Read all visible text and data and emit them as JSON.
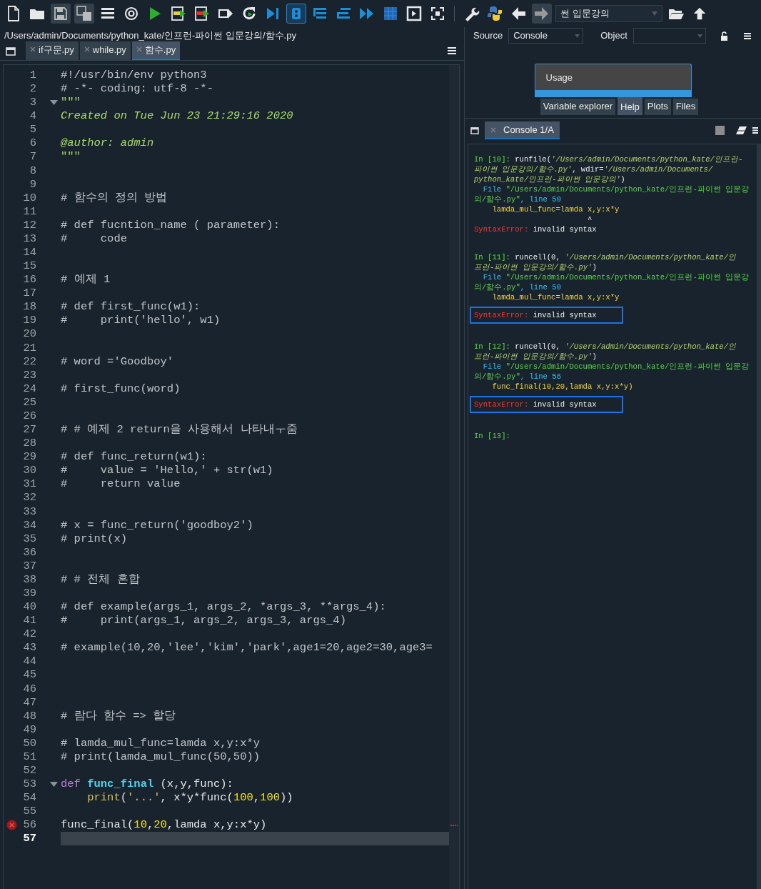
{
  "toolbar": {
    "directory": "썬 입문강의"
  },
  "editor": {
    "path": "/Users/admin/Documents/python_kate/인프런-파이썬 입문강의/함수.py",
    "tabs": [
      {
        "label": "if구문.py",
        "selected": false
      },
      {
        "label": "while.py",
        "selected": false
      },
      {
        "label": "함수.py",
        "selected": true
      }
    ],
    "lines": [
      {
        "number": "1",
        "tokens": [
          {
            "text": "#!/usr/bin/env python3",
            "kind": "comment"
          }
        ]
      },
      {
        "number": "2",
        "tokens": [
          {
            "text": "# -*- coding: utf-8 -*-",
            "kind": "comment"
          }
        ]
      },
      {
        "number": "3",
        "kind": "fold",
        "tokens": [
          {
            "text": "\"\"\"",
            "kind": "docquote"
          }
        ]
      },
      {
        "number": "4",
        "tokens": [
          {
            "text": "Created on Tue Jun 23 21:29:16 2020",
            "kind": "docstring"
          }
        ]
      },
      {
        "number": "5"
      },
      {
        "number": "6",
        "tokens": [
          {
            "text": "@author: admin",
            "kind": "docstring"
          }
        ]
      },
      {
        "number": "7",
        "tokens": [
          {
            "text": "\"\"\"",
            "kind": "docquote"
          }
        ]
      },
      {
        "number": "8"
      },
      {
        "number": "9"
      },
      {
        "number": "10",
        "tokens": [
          {
            "text": "# 함수의 정의 방법",
            "kind": "comment"
          }
        ]
      },
      {
        "number": "11"
      },
      {
        "number": "12",
        "tokens": [
          {
            "text": "# def fucntion_name ( parameter):",
            "kind": "comment"
          }
        ]
      },
      {
        "number": "13",
        "tokens": [
          {
            "text": "#     code",
            "kind": "comment"
          }
        ]
      },
      {
        "number": "14"
      },
      {
        "number": "15"
      },
      {
        "number": "16",
        "tokens": [
          {
            "text": "# 예제 1",
            "kind": "comment"
          }
        ]
      },
      {
        "number": "17"
      },
      {
        "number": "18",
        "tokens": [
          {
            "text": "# def first_func(w1):",
            "kind": "comment"
          }
        ]
      },
      {
        "number": "19",
        "tokens": [
          {
            "text": "#     print('hello', w1)",
            "kind": "comment"
          }
        ]
      },
      {
        "number": "20"
      },
      {
        "number": "21"
      },
      {
        "number": "22",
        "tokens": [
          {
            "text": "# word ='Goodboy'",
            "kind": "comment"
          }
        ]
      },
      {
        "number": "23"
      },
      {
        "number": "24",
        "tokens": [
          {
            "text": "# first_func(word)",
            "kind": "comment"
          }
        ]
      },
      {
        "number": "25"
      },
      {
        "number": "26"
      },
      {
        "number": "27",
        "tokens": [
          {
            "text": "# # 예제 2 return을 사용해서 나타내ㅜ줌",
            "kind": "comment"
          }
        ]
      },
      {
        "number": "28"
      },
      {
        "number": "29",
        "tokens": [
          {
            "text": "# def func_return(w1):",
            "kind": "comment"
          }
        ]
      },
      {
        "number": "30",
        "tokens": [
          {
            "text": "#     value = 'Hello,' + str(w1)",
            "kind": "comment"
          }
        ]
      },
      {
        "number": "31",
        "tokens": [
          {
            "text": "#     return value",
            "kind": "comment"
          }
        ]
      },
      {
        "number": "32"
      },
      {
        "number": "33"
      },
      {
        "number": "34",
        "tokens": [
          {
            "text": "# x = func_return('goodboy2')",
            "kind": "comment"
          }
        ]
      },
      {
        "number": "35",
        "tokens": [
          {
            "text": "# print(x)",
            "kind": "comment"
          }
        ]
      },
      {
        "number": "36"
      },
      {
        "number": "37"
      },
      {
        "number": "38",
        "tokens": [
          {
            "text": "# # 전체 혼합",
            "kind": "comment"
          }
        ]
      },
      {
        "number": "39"
      },
      {
        "number": "40",
        "tokens": [
          {
            "text": "# def example(args_1, args_2, *args_3, **args_4):",
            "kind": "comment"
          }
        ]
      },
      {
        "number": "41",
        "tokens": [
          {
            "text": "#     print(args_1, args_2, args_3, args_4)",
            "kind": "comment"
          }
        ]
      },
      {
        "number": "42"
      },
      {
        "number": "43",
        "tokens": [
          {
            "text": "# example(10,20,'lee','kim','park',age1=20,age2=30,age3=",
            "kind": "comment"
          }
        ]
      },
      {
        "number": "44"
      },
      {
        "number": "45"
      },
      {
        "number": "46"
      },
      {
        "number": "47"
      },
      {
        "number": "48",
        "tokens": [
          {
            "text": "# 람다 함수 => 할당",
            "kind": "comment"
          }
        ]
      },
      {
        "number": "49"
      },
      {
        "number": "50",
        "tokens": [
          {
            "text": "# lamda_mul_func=lamda x,y:x*y",
            "kind": "comment"
          }
        ]
      },
      {
        "number": "51",
        "tokens": [
          {
            "text": "# print(lamda_mul_func(50,50))",
            "kind": "comment"
          }
        ]
      },
      {
        "number": "52"
      },
      {
        "number": "53",
        "kind": "fold",
        "tokens": [
          {
            "text": "def ",
            "kind": "keyword"
          },
          {
            "text": "func_final",
            "kind": "defname"
          },
          {
            "text": " (x,y,func):",
            "kind": "plain"
          }
        ]
      },
      {
        "number": "54",
        "tokens": [
          {
            "text": "    print",
            "kind": "builtin"
          },
          {
            "text": "(",
            "kind": "plain"
          },
          {
            "text": "'...'",
            "kind": "string"
          },
          {
            "text": ", x*y*func(",
            "kind": "plain"
          },
          {
            "text": "100",
            "kind": "number"
          },
          {
            "text": ",",
            "kind": "plain"
          },
          {
            "text": "100",
            "kind": "number"
          },
          {
            "text": "))",
            "kind": "plain"
          }
        ]
      },
      {
        "number": "55"
      },
      {
        "number": "56",
        "kind": "error",
        "tokens": [
          {
            "text": "func_final(",
            "kind": "plain"
          },
          {
            "text": "10",
            "kind": "number"
          },
          {
            "text": ",",
            "kind": "plain"
          },
          {
            "text": "20",
            "kind": "number"
          },
          {
            "text": ",lamda x,y:x*y)",
            "kind": "plain"
          }
        ]
      },
      {
        "number": "57",
        "kind": "current"
      }
    ]
  },
  "right_pane": {
    "source_label": "Source",
    "source_value": "Console",
    "object_label": "Object",
    "help": {
      "usage": "Usage",
      "tabs": [
        {
          "label": "Variable explorer",
          "selected": false
        },
        {
          "label": "Help",
          "selected": true
        },
        {
          "label": "Plots",
          "selected": false
        },
        {
          "label": "Files",
          "selected": false
        }
      ]
    },
    "console": {
      "tab": "Console 1/A",
      "entries": [
        {
          "lines": [
            {
              "highlighted": false,
              "tokens": [
                {
                  "text": "In [10]: ",
                  "kind": "prompt"
                },
                {
                  "text": "runfile(",
                  "kind": "plain"
                },
                {
                  "text": "'/Users/admin/Documents/python_kate/인프런-",
                  "kind": "str"
                }
              ]
            },
            {
              "highlighted": false,
              "tokens": [
                {
                  "text": "파이썬 입문강의/함수.py'",
                  "kind": "str"
                },
                {
                  "text": ", wdir=",
                  "kind": "plain"
                },
                {
                  "text": "'/Users/admin/Documents/",
                  "kind": "str"
                }
              ]
            },
            {
              "highlighted": false,
              "tokens": [
                {
                  "text": "python_kate/인프런-파이썬 입문강의'",
                  "kind": "str"
                },
                {
                  "text": ")",
                  "kind": "plain"
                }
              ]
            },
            {
              "highlighted": false,
              "tokens": [
                {
                  "text": "  File ",
                  "kind": "file"
                },
                {
                  "text": "\"/Users/admin/Documents/python_kate/인프런-파이썬 입문강",
                  "kind": "path"
                }
              ]
            },
            {
              "highlighted": false,
              "tokens": [
                {
                  "text": "의/함수.py\"",
                  "kind": "path"
                },
                {
                  "text": ", line 50",
                  "kind": "file"
                }
              ]
            },
            {
              "highlighted": false,
              "tokens": [
                {
                  "text": "    lamda_mul_func=lamda x,y:x*y",
                  "kind": "code"
                }
              ]
            },
            {
              "highlighted": false,
              "tokens": [
                {
                  "text": "                         ^",
                  "kind": "plain"
                }
              ]
            },
            {
              "highlighted": false,
              "tokens": [
                {
                  "text": "SyntaxError:",
                  "kind": "error"
                },
                {
                  "text": " invalid syntax",
                  "kind": "plain"
                }
              ]
            }
          ]
        },
        {
          "lines": [
            {
              "highlighted": false,
              "tokens": [
                {
                  "text": "In [11]: ",
                  "kind": "prompt"
                },
                {
                  "text": "runcell(0, ",
                  "kind": "plain"
                },
                {
                  "text": "'/Users/admin/Documents/python_kate/인",
                  "kind": "str"
                }
              ]
            },
            {
              "highlighted": false,
              "tokens": [
                {
                  "text": "프런-파이썬 입문강의/함수.py'",
                  "kind": "str"
                },
                {
                  "text": ")",
                  "kind": "plain"
                }
              ]
            },
            {
              "highlighted": false,
              "tokens": [
                {
                  "text": "  File ",
                  "kind": "file"
                },
                {
                  "text": "\"/Users/admin/Documents/python_kate/인프런-파이썬 입문강",
                  "kind": "path"
                }
              ]
            },
            {
              "highlighted": false,
              "tokens": [
                {
                  "text": "의/함수.py\"",
                  "kind": "path"
                },
                {
                  "text": ", line 50",
                  "kind": "file"
                }
              ]
            },
            {
              "highlighted": false,
              "tokens": [
                {
                  "text": "    lamda_mul_func=lamda x,y:x*y",
                  "kind": "code"
                }
              ]
            },
            {
              "highlighted": true,
              "tokens": [
                {
                  "text": "SyntaxError:",
                  "kind": "error"
                },
                {
                  "text": " invalid syntax",
                  "kind": "plain"
                }
              ]
            }
          ]
        },
        {
          "lines": [
            {
              "highlighted": false,
              "tokens": [
                {
                  "text": "In [12]: ",
                  "kind": "prompt"
                },
                {
                  "text": "runcell(0, ",
                  "kind": "plain"
                },
                {
                  "text": "'/Users/admin/Documents/python_kate/인",
                  "kind": "str"
                }
              ]
            },
            {
              "highlighted": false,
              "tokens": [
                {
                  "text": "프런-파이썬 입문강의/함수.py'",
                  "kind": "str"
                },
                {
                  "text": ")",
                  "kind": "plain"
                }
              ]
            },
            {
              "highlighted": false,
              "tokens": [
                {
                  "text": "  File ",
                  "kind": "file"
                },
                {
                  "text": "\"/Users/admin/Documents/python_kate/인프런-파이썬 입문강",
                  "kind": "path"
                }
              ]
            },
            {
              "highlighted": false,
              "tokens": [
                {
                  "text": "의/함수.py\"",
                  "kind": "path"
                },
                {
                  "text": ", line 56",
                  "kind": "file"
                }
              ]
            },
            {
              "highlighted": false,
              "tokens": [
                {
                  "text": "    func_final(10,20,lamda x,y:x*y)",
                  "kind": "code"
                }
              ]
            },
            {
              "highlighted": true,
              "tokens": [
                {
                  "text": "SyntaxError:",
                  "kind": "error"
                },
                {
                  "text": " invalid syntax",
                  "kind": "plain"
                }
              ]
            }
          ]
        },
        {
          "lines": [
            {
              "highlighted": false,
              "tokens": [
                {
                  "text": "In [13]:",
                  "kind": "prompt"
                }
              ]
            }
          ]
        }
      ]
    }
  }
}
